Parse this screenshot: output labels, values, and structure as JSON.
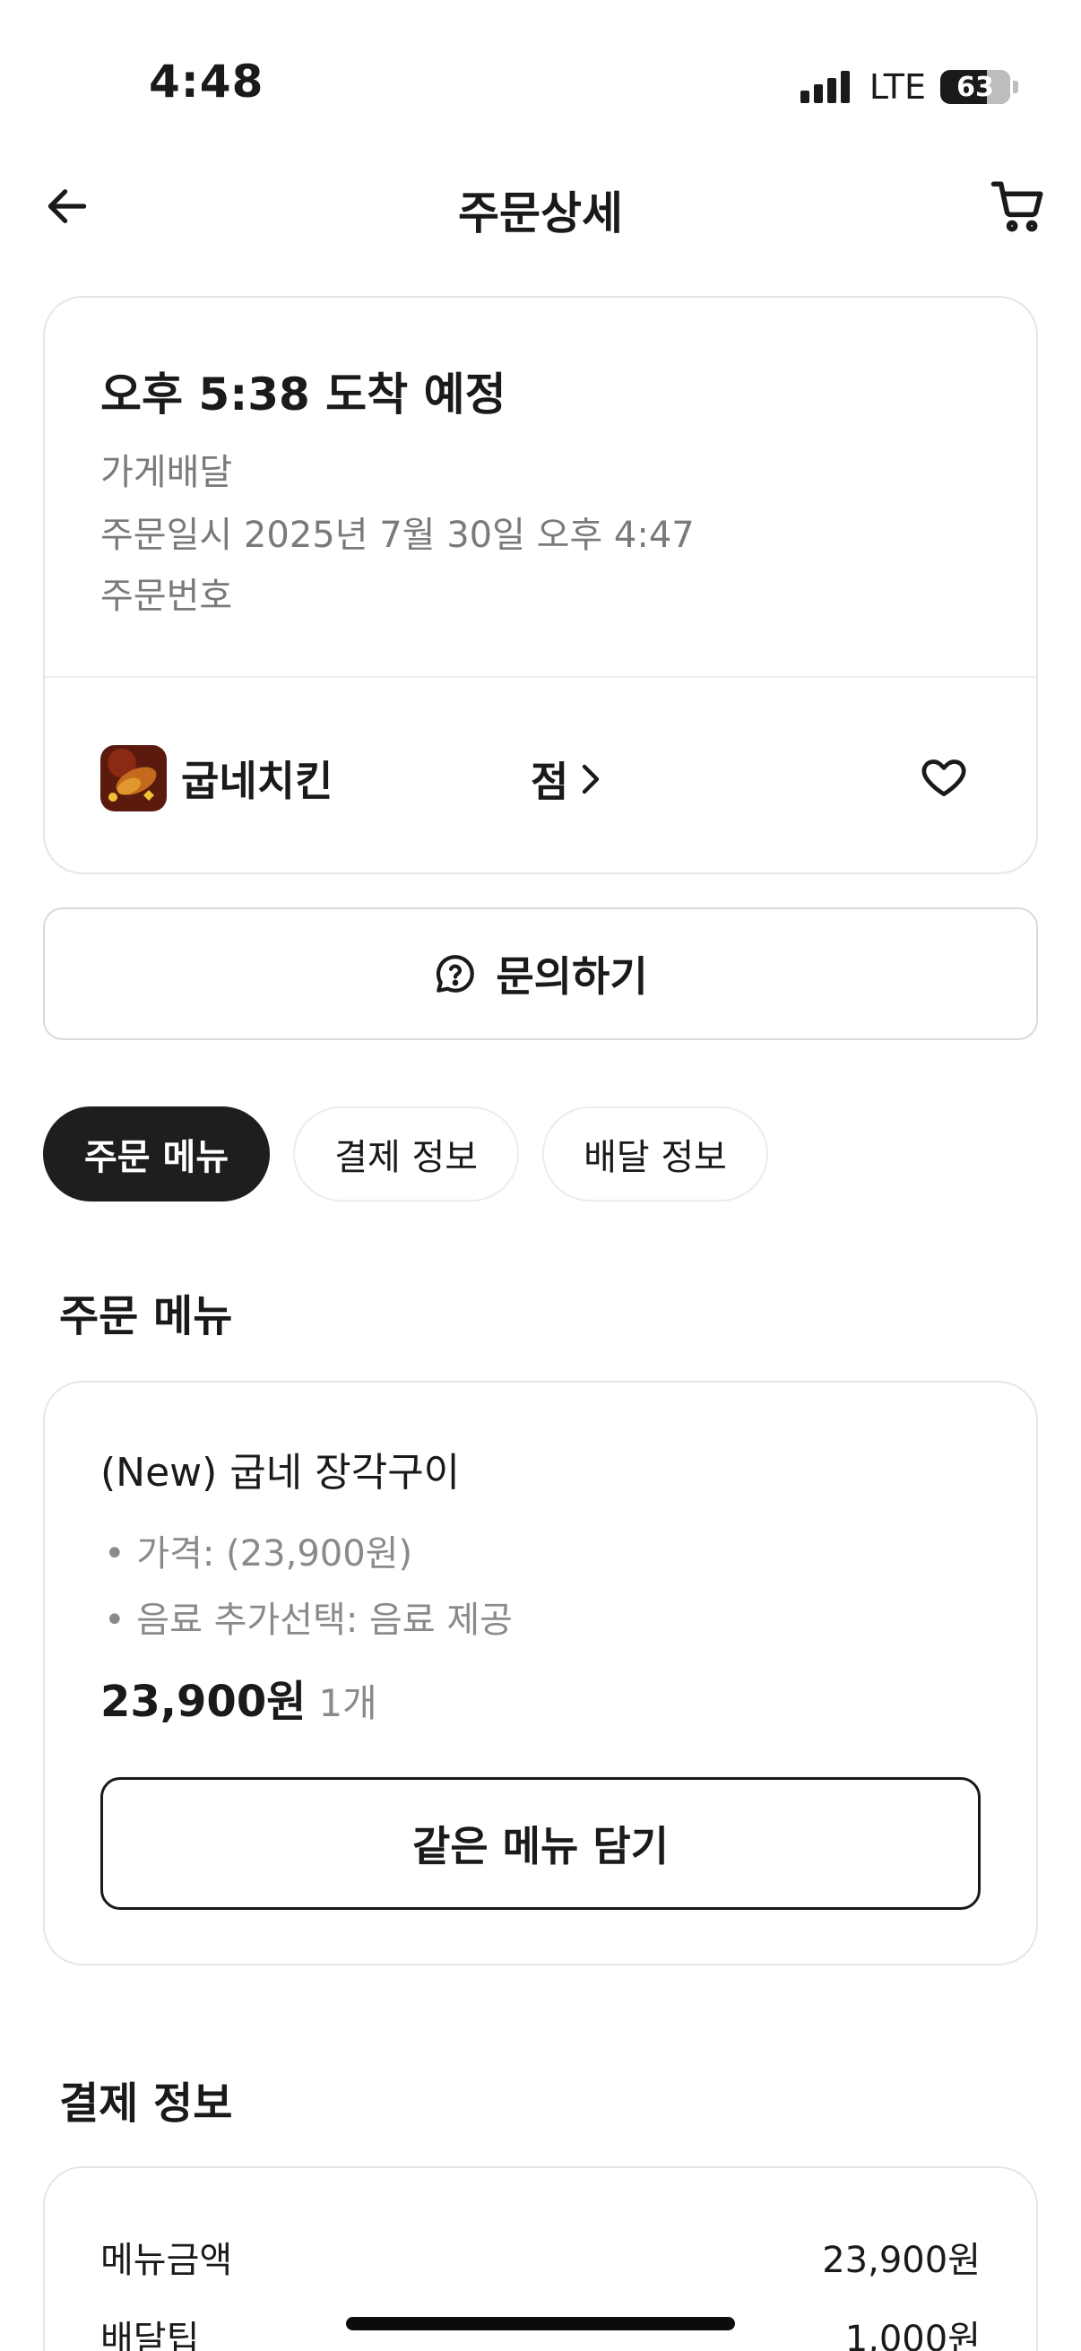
{
  "status_bar": {
    "time": "4:48",
    "network": "LTE",
    "battery": "63"
  },
  "header": {
    "title": "주문상세",
    "back_icon": "arrow-left-icon",
    "cart_icon": "cart-icon"
  },
  "order": {
    "eta": "오후 5:38 도착 예정",
    "delivery_type": "가게배달",
    "order_datetime": "주문일시 2025년 7월 30일 오후 4:47",
    "order_number_label": "주문번호",
    "store_name": "굽네치킨",
    "store_suffix": "점"
  },
  "inquiry": {
    "label": "문의하기",
    "icon": "question-bubble-icon"
  },
  "tabs": [
    {
      "label": "주문 메뉴",
      "active": true
    },
    {
      "label": "결제 정보",
      "active": false
    },
    {
      "label": "배달 정보",
      "active": false
    }
  ],
  "menu_section": {
    "title": "주문 메뉴",
    "item": {
      "name": "(New) 굽네 장각구이",
      "options": [
        "• 가격: (23,900원)",
        "• 음료 추가선택: 음료 제공"
      ],
      "price": "23,900원",
      "quantity": "1개"
    },
    "reorder_label": "같은 메뉴 담기"
  },
  "payment_section": {
    "title": "결제 정보",
    "rows": [
      {
        "label": "메뉴금액",
        "value": "23,900원"
      },
      {
        "label": "배달팁",
        "value": "1,000원"
      }
    ]
  },
  "colors": {
    "accent_dark": "#1e1e1e",
    "muted_text": "#7a7a7a",
    "border": "#e6e6e6"
  }
}
